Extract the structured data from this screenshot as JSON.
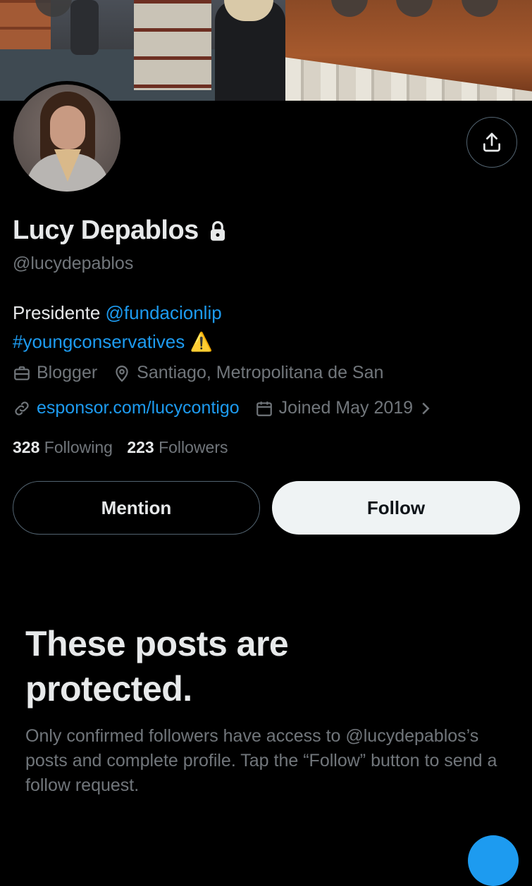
{
  "profile": {
    "name": "Lucy Depablos",
    "handle": "@lucydepablos",
    "bio": {
      "text": "Presidente ",
      "mention": "@fundacionlip",
      "hashtag": "#youngconservatives",
      "emoji": "⚠️"
    },
    "category": "Blogger",
    "location": "Santiago, Metropolitana de San",
    "website": "esponsor.com/lucycontigo",
    "joined": "Joined May 2019",
    "following_count": "328",
    "following_label": " Following",
    "followers_count": "223",
    "followers_label": " Followers"
  },
  "actions": {
    "mention_label": "Mention",
    "follow_label": "Follow"
  },
  "protected": {
    "title": "These posts are protected.",
    "body": "Only confirmed followers have access to @lucydepablos’s posts and complete profile. Tap the “Follow” button to send a follow request."
  },
  "colors": {
    "background": "#000000",
    "text_primary": "#e7e9ea",
    "text_secondary": "#71767b",
    "link": "#1d9bf0",
    "follow_button_bg": "#eff3f4"
  },
  "icons": [
    "share-icon",
    "lock-icon",
    "briefcase-icon",
    "location-pin-icon",
    "link-icon",
    "calendar-icon",
    "chevron-right-icon",
    "warning-emoji"
  ]
}
